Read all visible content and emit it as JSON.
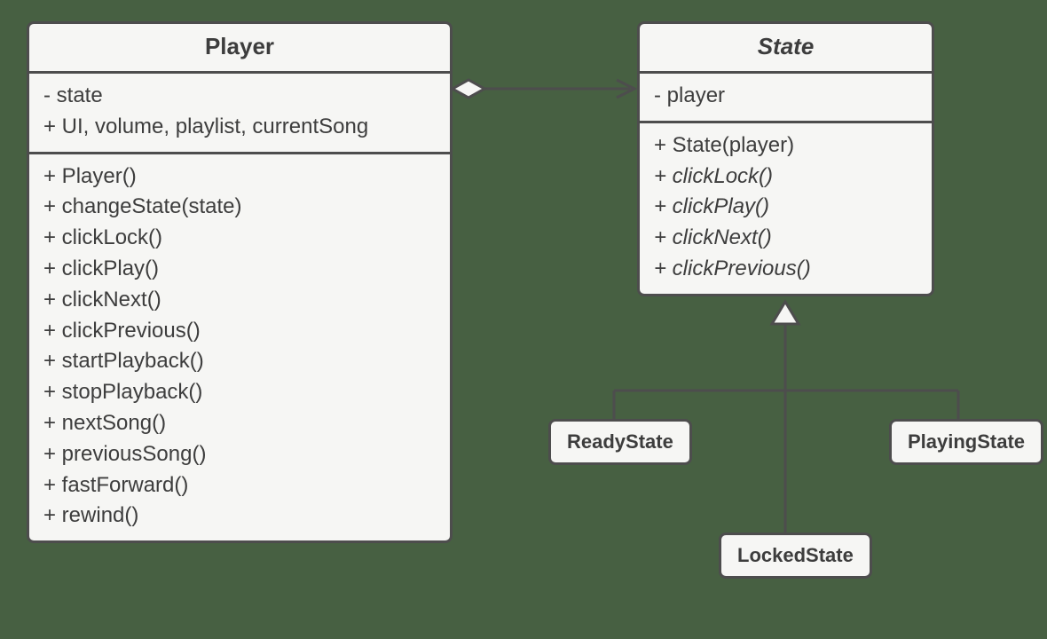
{
  "player_class": {
    "title": "Player",
    "attributes": [
      "- state",
      "+ UI, volume, playlist, currentSong"
    ],
    "operations": [
      "+ Player()",
      "+ changeState(state)",
      "+ clickLock()",
      "+ clickPlay()",
      "+ clickNext()",
      "+ clickPrevious()",
      "+ startPlayback()",
      "+ stopPlayback()",
      "+ nextSong()",
      "+ previousSong()",
      "+ fastForward()",
      "+ rewind()"
    ]
  },
  "state_class": {
    "title": "State",
    "attributes": [
      {
        "text": "- player",
        "italic": false
      }
    ],
    "operations": [
      {
        "text": "+ State(player)",
        "italic": false
      },
      {
        "text": "+ clickLock()",
        "italic": true
      },
      {
        "text": "+ clickPlay()",
        "italic": true
      },
      {
        "text": "+ clickNext()",
        "italic": true
      },
      {
        "text": "+ clickPrevious()",
        "italic": true
      }
    ]
  },
  "subclasses": {
    "ready": "ReadyState",
    "locked": "LockedState",
    "playing": "PlayingState"
  },
  "relations": {
    "aggregation": {
      "from": "player_class",
      "to": "state_class",
      "diamond_at": "player_class",
      "arrow_at": "state_class"
    },
    "generalization": {
      "parent": "state_class",
      "children": [
        "ready",
        "locked",
        "playing"
      ]
    }
  }
}
